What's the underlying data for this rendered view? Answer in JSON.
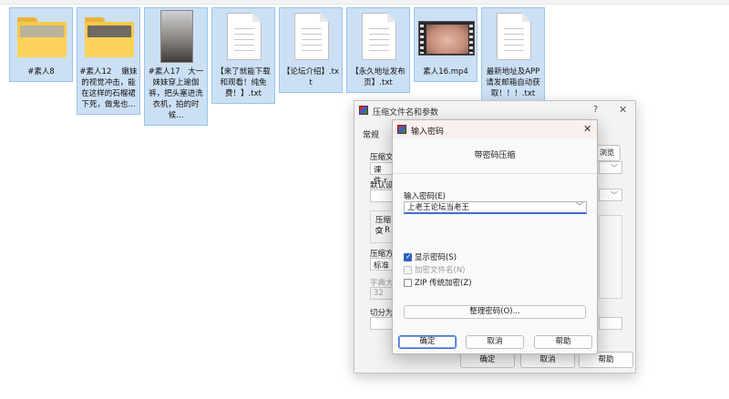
{
  "files": [
    {
      "name": "#素人8",
      "kind": "folder",
      "inner_color": "#b9b39c"
    },
    {
      "name": "#素人12　 嫩妹的视觉冲击，能在这样的石榴裙下死，做鬼也...",
      "kind": "folder",
      "inner_color": "#6f6a63"
    },
    {
      "name": "#素人17　大一妹妹穿上瑜伽裤，把头塞进洗衣机，拍的时候...",
      "kind": "photo"
    },
    {
      "name": "【来了就能下载和观看！纯免费！】.txt",
      "kind": "text"
    },
    {
      "name": "【论坛介绍】.txt",
      "kind": "text"
    },
    {
      "name": "【永久地址发布页】.txt",
      "kind": "text"
    },
    {
      "name": "素人16.mp4",
      "kind": "video"
    },
    {
      "name": "最新地址及APP请发邮箱自动获取！！！.txt",
      "kind": "text"
    }
  ],
  "archive_window": {
    "title": "压缩文件名和参数",
    "help_glyph": "?",
    "close_glyph": "✕",
    "tab": "常规",
    "archive_name_label": "压缩文",
    "archive_name_value": "课件.r",
    "browse_label": "浏览(B)...",
    "default_settings_label": "默认设",
    "format_label": "压缩文",
    "format_option": "R",
    "method_label": "压缩方",
    "method_value": "标准",
    "dict_label": "字典大",
    "dict_value": "32",
    "split_label": "切分为",
    "ok": "确定",
    "cancel": "取消",
    "help": "帮助"
  },
  "password_dialog": {
    "title": "输入密码",
    "close_glyph": "✕",
    "heading": "带密码压缩",
    "password_label": "输入密码(E)",
    "password_value": "上老王论坛当老王",
    "show_password": {
      "label": "显示密码(S)",
      "checked": true,
      "enabled": true
    },
    "encrypt_names": {
      "label": "加密文件名(N)",
      "checked": false,
      "enabled": false
    },
    "zip_legacy": {
      "label": "ZIP 传统加密(Z)",
      "checked": false,
      "enabled": true
    },
    "organize_label": "整理密码(O)...",
    "ok": "确定",
    "cancel": "取消",
    "help": "帮助"
  },
  "colors": {
    "selection_bg": "#cce0f5",
    "selection_border": "#99c3ec",
    "accent": "#3d6fcc"
  }
}
